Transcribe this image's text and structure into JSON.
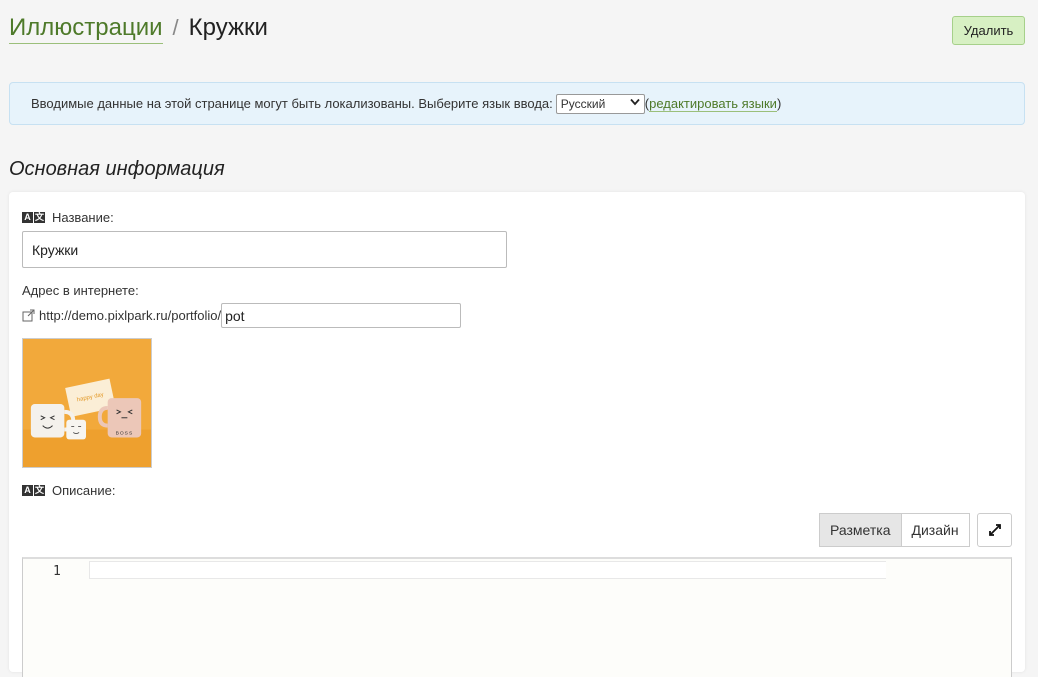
{
  "header": {
    "breadcrumb_parent": "Иллюстрации",
    "separator": "/",
    "title": "Кружки",
    "delete_label": "Удалить"
  },
  "locale_bar": {
    "text": "Вводимые данные на этой странице могут быть локализованы. Выберите язык ввода:",
    "selected_language": "Русский",
    "open_paren": "(",
    "edit_link": "редактировать языки",
    "close_paren": ")"
  },
  "section": {
    "title": "Основная информация"
  },
  "form": {
    "name_label": "Название:",
    "name_value": "Кружки",
    "url_label": "Адрес в интернете:",
    "url_prefix": "http://demo.pixlpark.ru/portfolio/",
    "url_slug": "pot",
    "description_label": "Описание:"
  },
  "thumbnail": {
    "mug_caption": "BOSS",
    "card_caption": "happy day"
  },
  "editor": {
    "tab_markup": "Разметка",
    "tab_design": "Дизайн",
    "line_number": "1"
  },
  "colors": {
    "accent_link": "#4e7a2a",
    "delete_bg": "#d7f0c3",
    "info_bg": "#e7f3fb",
    "thumb_bg": "#f2a93b"
  }
}
